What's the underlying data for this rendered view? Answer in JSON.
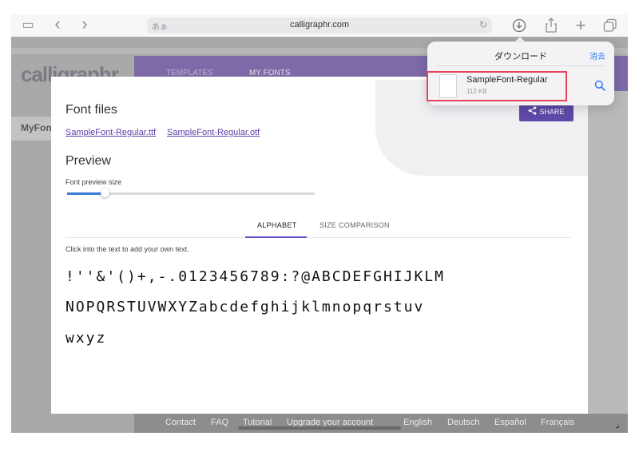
{
  "browser": {
    "url": "calligraphr.com",
    "text_size_label": "あぁ",
    "icons": {
      "sidebar": "▭",
      "back": "‹",
      "forward": "›",
      "lock": "🔒",
      "reload": "↻",
      "downloads": "⊕",
      "share": "⇪",
      "new_tab": "+",
      "tabs": "❐"
    }
  },
  "site": {
    "logo": "calligraphr",
    "nav": [
      "TEMPLATES",
      "MY FONTS"
    ],
    "sidebar_label": "MyFon",
    "footer_links": [
      "Contact",
      "FAQ",
      "Tutorial",
      "Upgrade your account",
      "English",
      "Deutsch",
      "Español",
      "Français"
    ]
  },
  "modal": {
    "share_label": "SHARE",
    "font_files_heading": "Font files",
    "files": [
      "SampleFont-Regular.ttf",
      "SampleFont-Regular.otf"
    ],
    "preview_heading": "Preview",
    "preview_size_label": "Font preview size",
    "preview_size_fraction": 0.15,
    "tabs": [
      "ALPHABET",
      "SIZE COMPARISON"
    ],
    "active_tab": "ALPHABET",
    "hint": "Click into the text to add your own text.",
    "sample_lines": [
      "!''&'()+,-.0123456789:?@ABCDEFGHIJKLM",
      "NOPQRSTUVWXYZabcdefghijklmnopqrstuv",
      "wxyz"
    ]
  },
  "downloads": {
    "title": "ダウンロード",
    "clear_label": "消去",
    "item": {
      "name": "SampleFont-Regular",
      "size": "112 KB"
    },
    "highlight_color": "#e8435a",
    "accent_color": "#2f7bf6"
  },
  "colors": {
    "brand_purple": "#7d6aa7",
    "link_purple": "#5d3ea6"
  }
}
